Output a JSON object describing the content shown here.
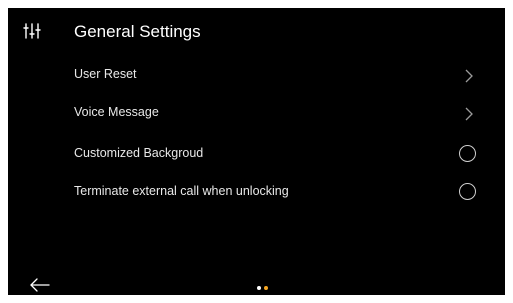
{
  "header": {
    "title": "General Settings",
    "icon": "sliders-icon"
  },
  "rows": [
    {
      "label": "User Reset",
      "control": "chevron-right-icon"
    },
    {
      "label": "Voice Message",
      "control": "chevron-right-icon"
    },
    {
      "label": "Customized Backgroud",
      "control": "radio-unchecked"
    },
    {
      "label": "Terminate external call when unlocking",
      "control": "radio-unchecked"
    }
  ],
  "footer": {
    "back_icon": "back-arrow-icon",
    "page_count": 2,
    "active_page": 2
  },
  "colors": {
    "background": "#000000",
    "text": "#ffffff",
    "accent": "#f5a623",
    "inactive_dot": "#ffffff"
  }
}
